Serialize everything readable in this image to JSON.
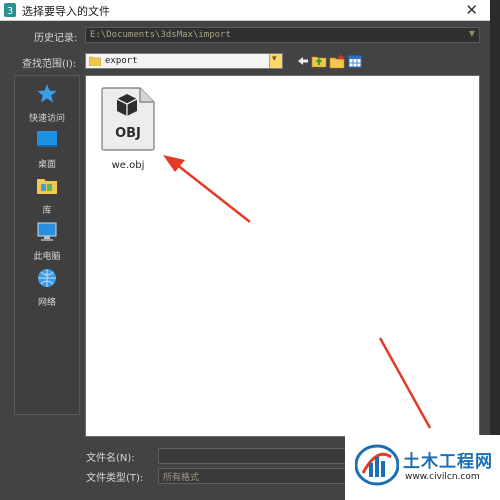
{
  "window": {
    "title": "选择要导入的文件",
    "close_glyph": "✕"
  },
  "history": {
    "label": "历史记录:",
    "value": "E:\\Documents\\3dsMax\\import"
  },
  "look_in": {
    "label": "查找范围(I):",
    "value": "export"
  },
  "places": [
    {
      "label": "快速访问",
      "icon": "star-icon"
    },
    {
      "label": "桌面",
      "icon": "desktop-icon"
    },
    {
      "label": "库",
      "icon": "library-icon"
    },
    {
      "label": "此电脑",
      "icon": "computer-icon"
    },
    {
      "label": "网络",
      "icon": "network-icon"
    }
  ],
  "files": [
    {
      "name": "we.obj",
      "badge": "OBJ",
      "icon": "obj-file-icon"
    }
  ],
  "filename": {
    "label": "文件名(N):",
    "value": ""
  },
  "filetype": {
    "label": "文件类型(T):",
    "value": "所有格式"
  },
  "watermark": {
    "title": "土木工程网",
    "url": "www.civilcn.com"
  },
  "colors": {
    "accent": "#1a6fb5",
    "arrow": "#e53a26",
    "dialog_bg": "#434343"
  }
}
